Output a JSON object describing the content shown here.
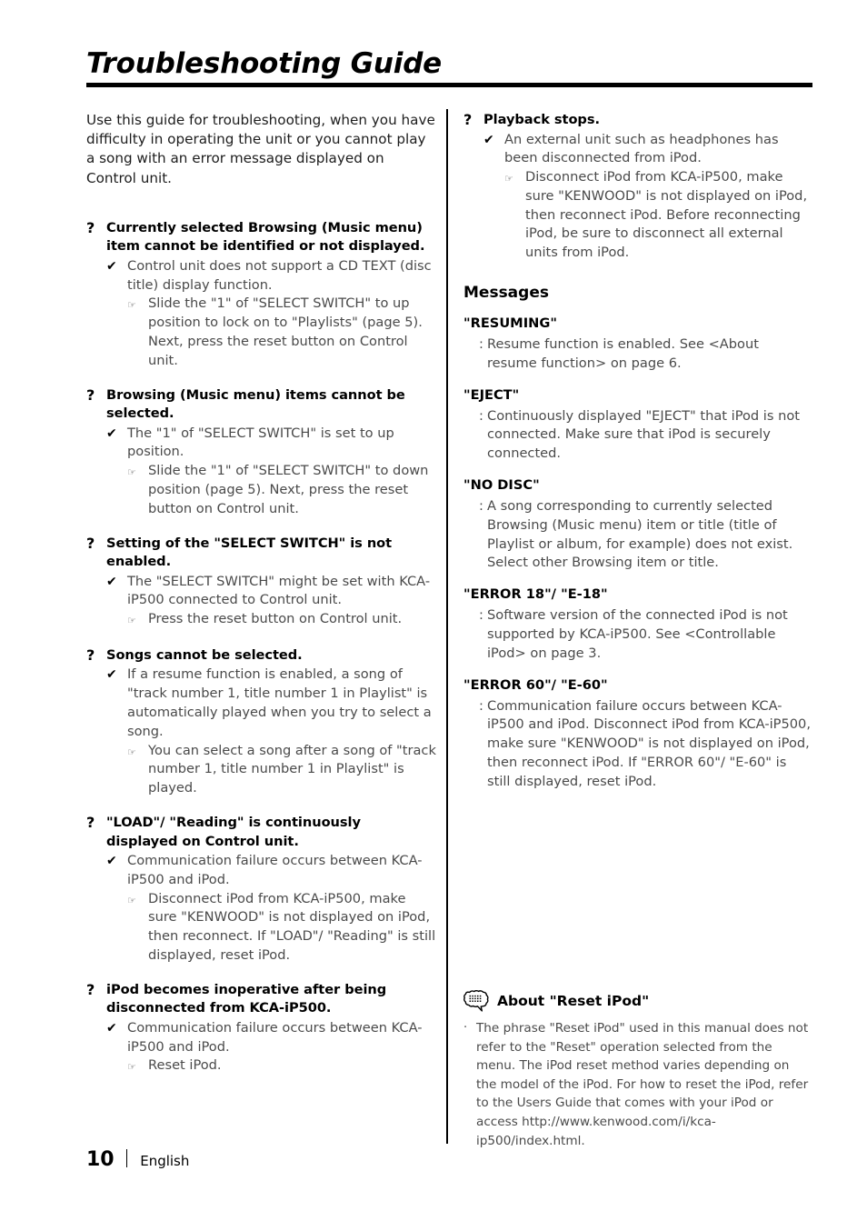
{
  "document": {
    "title": "Troubleshooting Guide",
    "intro": "Use this guide for troubleshooting, when you have difficulty in operating the unit or you cannot play a song with an error message displayed on Control unit.",
    "marks": {
      "question": "?",
      "cause": "✔",
      "fix": "☞",
      "colon": ":",
      "bullet": "·"
    }
  },
  "left_column": {
    "items": [
      {
        "question": "Currently selected Browsing (Music menu) item cannot be identified or not displayed.",
        "cause": "Control unit does not support a CD TEXT (disc title) display function.",
        "fix": "Slide the \"1\" of \"SELECT SWITCH\" to up position to lock on to \"Playlists\" (page 5). Next, press the reset button on Control unit."
      },
      {
        "question": "Browsing (Music menu) items cannot be selected.",
        "cause": "The \"1\" of \"SELECT SWITCH\" is set to up position.",
        "fix": "Slide the \"1\" of \"SELECT SWITCH\" to down position (page 5). Next, press the reset button on Control unit."
      },
      {
        "question": "Setting of the \"SELECT SWITCH\" is not enabled.",
        "cause": "The \"SELECT SWITCH\" might be set with KCA-iP500 connected to Control unit.",
        "fix": "Press the reset button on Control unit."
      },
      {
        "question": "Songs cannot be selected.",
        "cause": "If a resume function is enabled, a song of \"track number 1, title number 1 in Playlist\" is automatically played when you try to select a song.",
        "fix": "You can select a song after a song of \"track number 1, title number 1 in Playlist\" is played."
      },
      {
        "question": "\"LOAD\"/ \"Reading\" is continuously displayed on Control unit.",
        "cause": "Communication failure occurs between KCA-iP500 and iPod.",
        "fix": "Disconnect iPod from KCA-iP500, make sure \"KENWOOD\" is not displayed on iPod, then reconnect. If \"LOAD\"/ \"Reading\" is still displayed, reset iPod."
      },
      {
        "question": "iPod becomes inoperative after being disconnected from KCA-iP500.",
        "cause": "Communication failure occurs between KCA-iP500 and iPod.",
        "fix": "Reset iPod."
      }
    ]
  },
  "right_column": {
    "items": [
      {
        "question": "Playback stops.",
        "cause": "An external unit such as headphones has been disconnected from iPod.",
        "fix": "Disconnect iPod from KCA-iP500, make sure \"KENWOOD\" is not displayed on iPod, then reconnect iPod. Before reconnecting iPod, be sure to disconnect all external units from iPod."
      }
    ],
    "messages_heading": "Messages",
    "messages": [
      {
        "term": "\"RESUMING\"",
        "definition": "Resume function is enabled. See <About resume function> on page 6."
      },
      {
        "term": "\"EJECT\"",
        "definition": "Continuously displayed \"EJECT\" that iPod is not connected. Make sure that iPod is securely connected."
      },
      {
        "term": "\"NO DISC\"",
        "definition": "A song corresponding to currently selected Browsing (Music menu) item or title (title of Playlist or album, for example) does not exist. Select other Browsing item or title."
      },
      {
        "term": "\"ERROR 18\"/ \"E-18\"",
        "definition": "Software version of the connected iPod is not supported by KCA-iP500. See <Controllable iPod> on page 3."
      },
      {
        "term": "\"ERROR 60\"/ \"E-60\"",
        "definition": "Communication failure occurs between KCA-iP500 and iPod. Disconnect iPod from KCA-iP500, make sure \"KENWOOD\" is not displayed on iPod, then reconnect iPod. If \"ERROR 60\"/ \"E-60\" is still displayed, reset iPod."
      }
    ]
  },
  "note": {
    "icon": "speech-bubble-note-icon",
    "title": "About \"Reset iPod\"",
    "text": "The phrase \"Reset iPod\" used in this manual does not refer to the \"Reset\" operation selected from the menu. The iPod reset method varies depending on the model of the iPod. For how to reset the iPod, refer to the Users Guide that comes with your iPod or access http://www.kenwood.com/i/kca-ip500/index.html."
  },
  "footer": {
    "page_number": "10",
    "language": "English"
  },
  "colors": {
    "text": "#4a4a4a",
    "heading": "#000000",
    "rule": "#000000",
    "background": "#ffffff"
  }
}
